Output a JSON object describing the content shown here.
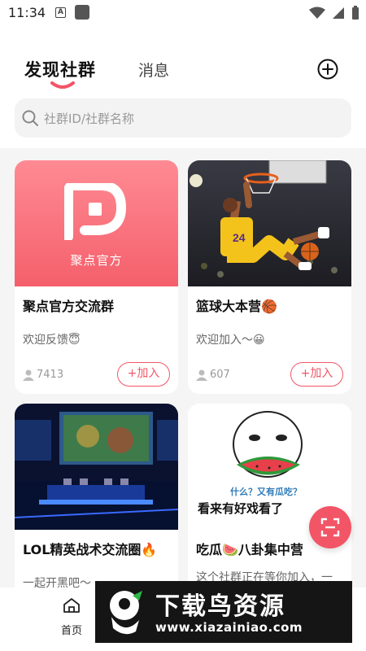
{
  "status_bar": {
    "time": "11:34",
    "app_icon_letter": "A"
  },
  "header": {
    "tab_discover": "发现社群",
    "tab_messages": "消息"
  },
  "search": {
    "placeholder": "社群ID/社群名称"
  },
  "groups": [
    {
      "title": "聚点官方交流群",
      "desc": "欢迎反馈😇",
      "members": "7413",
      "join_label": "+加入",
      "image_label": "聚点官方"
    },
    {
      "title": "篮球大本营🏀",
      "desc": "欢迎加入～😀",
      "members": "607",
      "join_label": "+加入"
    },
    {
      "title": "LOL精英战术交流圈🔥",
      "desc": "一起开黑吧～"
    },
    {
      "title": "吃瓜🍉八卦集中营",
      "desc": "这个社群正在等你加入，一",
      "image_text_top": "什么？又有瓜吃？",
      "image_text_bottom": "看来有好戏看了"
    }
  ],
  "bottom_nav": {
    "home_label": "首页"
  },
  "watermark": {
    "title": "下载鸟资源",
    "url": "www.xiazainiao.com"
  },
  "colors": {
    "accent": "#f25566"
  }
}
